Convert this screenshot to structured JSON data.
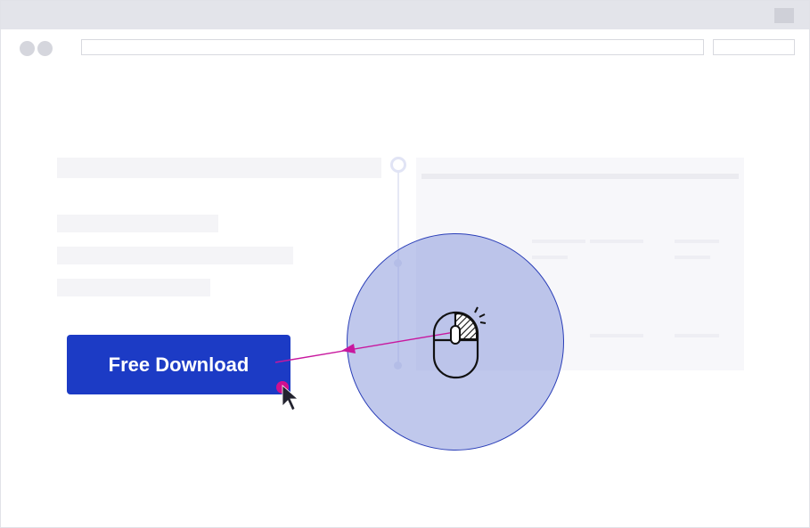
{
  "button": {
    "label": "Free Download"
  },
  "colors": {
    "button_bg": "#1c3bc5",
    "highlight_circle": "#8c9bdc",
    "arrow": "#c8179e",
    "click_marker": "#d0108f",
    "cursor": "#23232f"
  },
  "icons": {
    "mouse": "mouse-left-click-icon",
    "cursor": "arrow-cursor-icon"
  }
}
